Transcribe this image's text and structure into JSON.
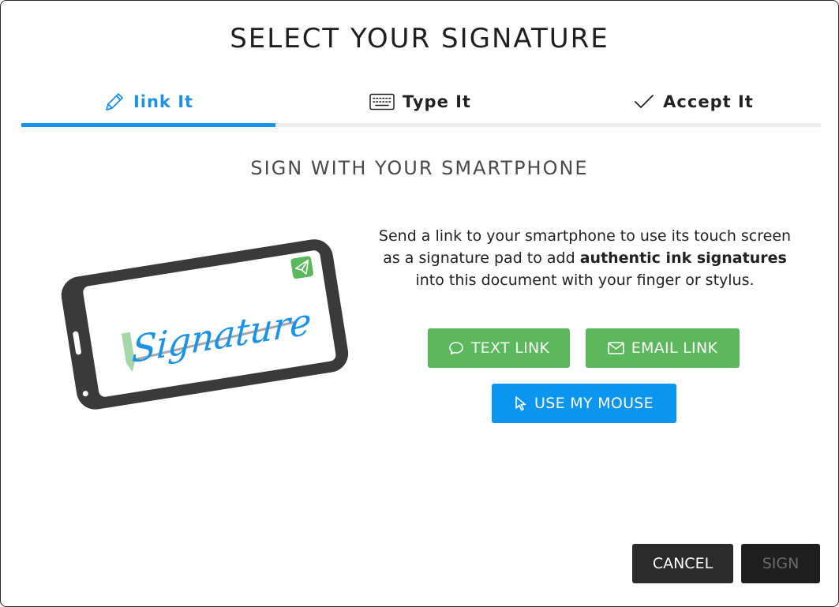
{
  "dialog": {
    "title": "SELECT YOUR SIGNATURE",
    "tabs": [
      {
        "label": "Iink It",
        "icon": "pencil-icon",
        "active": true
      },
      {
        "label": "Type It",
        "icon": "keyboard-icon",
        "active": false
      },
      {
        "label": "Accept It",
        "icon": "checkmark-icon",
        "active": false
      }
    ],
    "subtitle": "SIGN WITH YOUR SMARTPHONE",
    "illustration": {
      "signature_text": "Signature",
      "icon": "paper-plane-icon"
    },
    "description": {
      "part1": "Send a link to your smartphone to use its touch screen as a signature pad to add ",
      "bold": "authentic ink signatures",
      "part2": " into this document with your finger or stylus."
    },
    "buttons": {
      "text_link": "TEXT LINK",
      "email_link": "EMAIL LINK",
      "use_mouse": "USE MY MOUSE"
    },
    "footer": {
      "cancel": "CANCEL",
      "sign": "SIGN"
    },
    "colors": {
      "accent_blue": "#1a93e8",
      "green_button": "#5cb85c",
      "blue_button": "#0a95f0",
      "dark_button": "#2b2b2b"
    }
  }
}
